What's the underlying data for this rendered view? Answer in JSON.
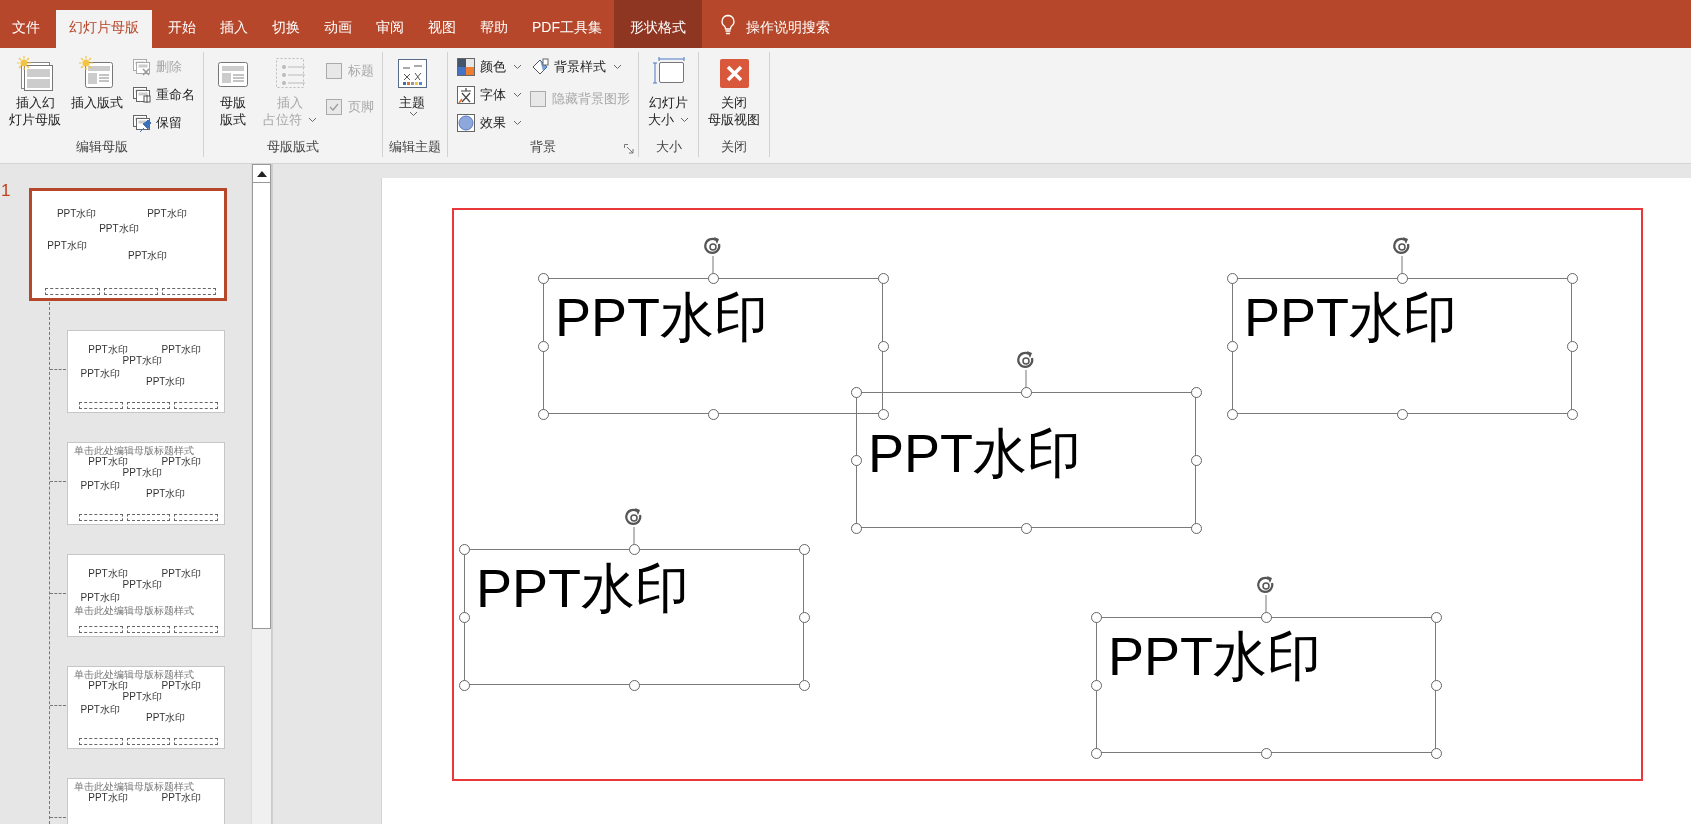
{
  "tabs": [
    {
      "label": "文件",
      "selected": false,
      "contextual": false
    },
    {
      "label": "幻灯片母版",
      "selected": true,
      "contextual": false
    },
    {
      "label": "开始",
      "selected": false,
      "contextual": false
    },
    {
      "label": "插入",
      "selected": false,
      "contextual": false
    },
    {
      "label": "切换",
      "selected": false,
      "contextual": false
    },
    {
      "label": "动画",
      "selected": false,
      "contextual": false
    },
    {
      "label": "审阅",
      "selected": false,
      "contextual": false
    },
    {
      "label": "视图",
      "selected": false,
      "contextual": false
    },
    {
      "label": "帮助",
      "selected": false,
      "contextual": false
    },
    {
      "label": "PDF工具集",
      "selected": false,
      "contextual": false
    },
    {
      "label": "形状格式",
      "selected": false,
      "contextual": true
    }
  ],
  "tell_me": "操作说明搜索",
  "ribbon": {
    "groups": [
      {
        "label": "编辑母版",
        "columns": [
          [
            {
              "kind": "big",
              "lines": [
                "插入幻",
                "灯片母版"
              ],
              "disabled": false,
              "dropdown": false
            }
          ],
          [
            {
              "kind": "big",
              "lines": [
                "插入版式"
              ],
              "disabled": false,
              "dropdown": false
            }
          ],
          [
            {
              "kind": "small",
              "lines": [
                "删除"
              ],
              "disabled": true,
              "dropdown": false
            },
            {
              "kind": "small",
              "lines": [
                "重命名"
              ],
              "disabled": false,
              "dropdown": false
            },
            {
              "kind": "small",
              "lines": [
                "保留"
              ],
              "disabled": false,
              "dropdown": false
            }
          ]
        ]
      },
      {
        "label": "母版版式",
        "columns": [
          [
            {
              "kind": "big",
              "lines": [
                "母版",
                "版式"
              ],
              "disabled": false,
              "dropdown": false
            }
          ],
          [
            {
              "kind": "big",
              "lines": [
                "插入",
                "占位符"
              ],
              "disabled": true,
              "dropdown": true
            }
          ],
          [
            {
              "kind": "check",
              "lines": [
                "标题"
              ],
              "disabled": true,
              "checked": false
            },
            {
              "kind": "check",
              "lines": [
                "页脚"
              ],
              "disabled": true,
              "checked": true
            }
          ]
        ]
      },
      {
        "label": "编辑主题",
        "columns": [
          [
            {
              "kind": "big",
              "lines": [
                "主题"
              ],
              "disabled": false,
              "dropdown": true
            }
          ]
        ]
      },
      {
        "label": "背景",
        "launcher": true,
        "columns": [
          [
            {
              "kind": "small",
              "lines": [
                "颜色"
              ],
              "disabled": false,
              "dropdown": true
            },
            {
              "kind": "small",
              "lines": [
                "字体"
              ],
              "disabled": false,
              "dropdown": true
            },
            {
              "kind": "small",
              "lines": [
                "效果"
              ],
              "disabled": false,
              "dropdown": true
            }
          ],
          [
            {
              "kind": "small",
              "lines": [
                "背景样式"
              ],
              "disabled": false,
              "dropdown": true
            },
            {
              "kind": "check",
              "lines": [
                "隐藏背景图形"
              ],
              "disabled": true,
              "checked": false
            }
          ]
        ]
      },
      {
        "label": "大小",
        "columns": [
          [
            {
              "kind": "big",
              "lines": [
                "幻灯片",
                "大小"
              ],
              "disabled": false,
              "dropdown": true
            }
          ]
        ]
      },
      {
        "label": "关闭",
        "columns": [
          [
            {
              "kind": "big",
              "lines": [
                "关闭",
                "母版视图"
              ],
              "disabled": false,
              "dropdown": false
            }
          ]
        ]
      }
    ]
  },
  "thumbnails": [
    {
      "number": "1",
      "selected": true,
      "texts": [
        {
          "kind": "watermark",
          "text": "PPT水印"
        },
        {
          "kind": "watermark",
          "text": "PPT水印"
        },
        {
          "kind": "watermark",
          "text": "PPT水印"
        },
        {
          "kind": "watermark",
          "text": "PPT水印"
        },
        {
          "kind": "watermark",
          "text": "PPT水印"
        }
      ]
    },
    {
      "selected": false,
      "texts": [
        {
          "kind": "watermark",
          "text": "PPT水印"
        },
        {
          "kind": "watermark",
          "text": "PPT水印"
        },
        {
          "kind": "watermark",
          "text": "PPT水印"
        },
        {
          "kind": "watermark",
          "text": "PPT水印"
        },
        {
          "kind": "watermark",
          "text": "PPT水印"
        }
      ]
    },
    {
      "selected": false,
      "texts": [
        {
          "kind": "title",
          "text": "单击此处编辑母版标题样式"
        },
        {
          "kind": "watermark",
          "text": "PPT水印"
        },
        {
          "kind": "watermark",
          "text": "PPT水印"
        },
        {
          "kind": "watermark",
          "text": "PPT水印"
        },
        {
          "kind": "watermark",
          "text": "PPT水印"
        },
        {
          "kind": "watermark",
          "text": "PPT水印"
        }
      ]
    },
    {
      "selected": false,
      "texts": [
        {
          "kind": "watermark",
          "text": "PPT水印"
        },
        {
          "kind": "watermark",
          "text": "PPT水印"
        },
        {
          "kind": "watermark",
          "text": "PPT水印"
        },
        {
          "kind": "watermark",
          "text": "PPT水印"
        },
        {
          "kind": "title",
          "text": "单击此处编辑母版标题样式"
        }
      ]
    },
    {
      "selected": false,
      "texts": [
        {
          "kind": "title",
          "text": "单击此处编辑母版标题样式"
        },
        {
          "kind": "watermark",
          "text": "PPT水印"
        },
        {
          "kind": "watermark",
          "text": "PPT水印"
        },
        {
          "kind": "watermark",
          "text": "PPT水印"
        },
        {
          "kind": "watermark",
          "text": "PPT水印"
        },
        {
          "kind": "watermark",
          "text": "PPT水印"
        }
      ]
    },
    {
      "selected": false,
      "texts": [
        {
          "kind": "title",
          "text": "单击此处编辑母版标题样式"
        },
        {
          "kind": "watermark",
          "text": "PPT水印"
        },
        {
          "kind": "watermark",
          "text": "PPT水印"
        }
      ]
    }
  ],
  "slide": {
    "text_boxes": [
      {
        "text": "PPT水印",
        "selected": true
      },
      {
        "text": "PPT水印",
        "selected": true
      },
      {
        "text": "PPT水印",
        "selected": true
      },
      {
        "text": "PPT水印",
        "selected": true
      },
      {
        "text": "PPT水印",
        "selected": true
      }
    ]
  }
}
